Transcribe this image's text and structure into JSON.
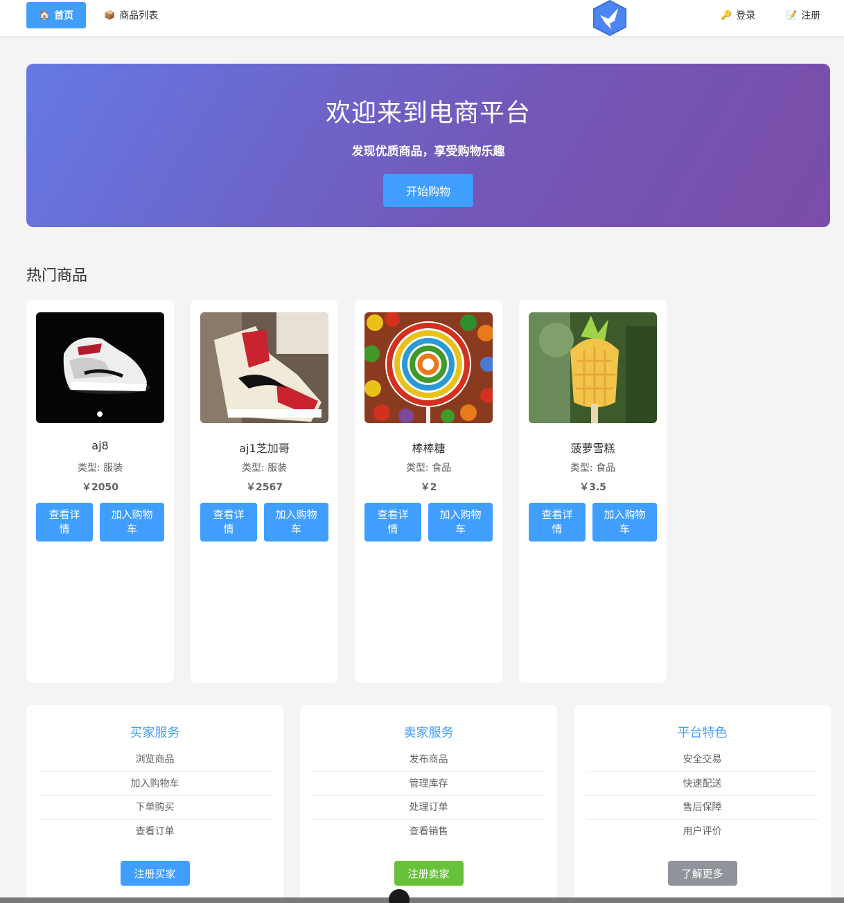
{
  "nav": {
    "home": {
      "label": "首页",
      "icon": "house-icon"
    },
    "products": {
      "label": "商品列表",
      "icon": "package-icon"
    },
    "login": {
      "label": "登录",
      "icon": "key-icon"
    },
    "register": {
      "label": "注册",
      "icon": "memo-icon"
    },
    "logo_icon": "bird-hexagon-logo"
  },
  "hero": {
    "title": "欢迎来到电商平台",
    "subtitle": "发现优质商品，享受购物乐趣",
    "button": "开始购物",
    "gradient": [
      "#6578e4",
      "#7a4da8"
    ]
  },
  "section": {
    "title": "热门商品"
  },
  "products": [
    {
      "name": "aj8",
      "type": "类型: 服装",
      "price": "￥2050",
      "detail": "查看详情",
      "cart": "加入购物车",
      "image": "black-white-sneaker"
    },
    {
      "name": "aj1芝加哥",
      "type": "类型: 服装",
      "price": "￥2567",
      "detail": "查看详情",
      "cart": "加入购物车",
      "image": "red-white-sneaker"
    },
    {
      "name": "棒棒糖",
      "type": "类型: 食品",
      "price": "￥2",
      "detail": "查看详情",
      "cart": "加入购物车",
      "image": "rainbow-lollipop"
    },
    {
      "name": "菠萝雪糕",
      "type": "类型: 食品",
      "price": "￥3.5",
      "detail": "查看详情",
      "cart": "加入购物车",
      "image": "pineapple-popsicle"
    }
  ],
  "panels": [
    {
      "title": "买家服务",
      "items": [
        "浏览商品",
        "加入购物车",
        "下单购买",
        "查看订单"
      ],
      "button": "注册买家",
      "button_color": "#409eff"
    },
    {
      "title": "卖家服务",
      "items": [
        "发布商品",
        "管理库存",
        "处理订单",
        "查看销售"
      ],
      "button": "注册卖家",
      "button_color": "#67c23a"
    },
    {
      "title": "平台特色",
      "items": [
        "安全交易",
        "快速配送",
        "售后保障",
        "用户评价"
      ],
      "button": "了解更多",
      "button_color": "#909399"
    }
  ],
  "colors": {
    "primary": "#409eff",
    "success": "#67c23a",
    "info": "#909399"
  }
}
